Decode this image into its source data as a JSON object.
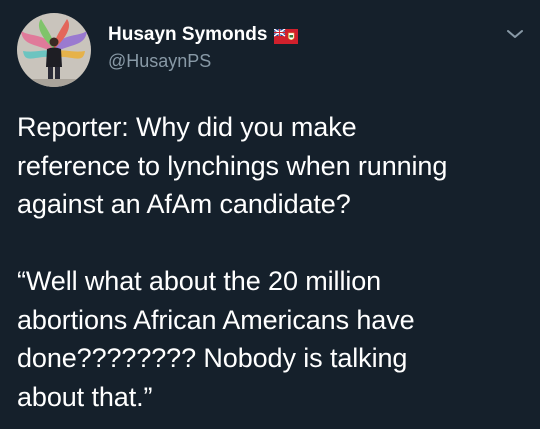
{
  "author": {
    "display_name": "Husayn Symonds",
    "handle": "@HusaynPS",
    "avatar_icon": "profile-photo",
    "flag_icon": "bermuda-flag-icon"
  },
  "menu_icon": "chevron-down-icon",
  "tweet": {
    "text": "Reporter: Why did you make\nreference to lynchings when running\nagainst an AfAm candidate?\n\n“Well what about the 20 million\nabortions African Americans have\ndone???????? Nobody is talking\nabout that.”"
  },
  "colors": {
    "background": "#15202b",
    "text": "#ffffff",
    "secondary_text": "#8899a6"
  }
}
